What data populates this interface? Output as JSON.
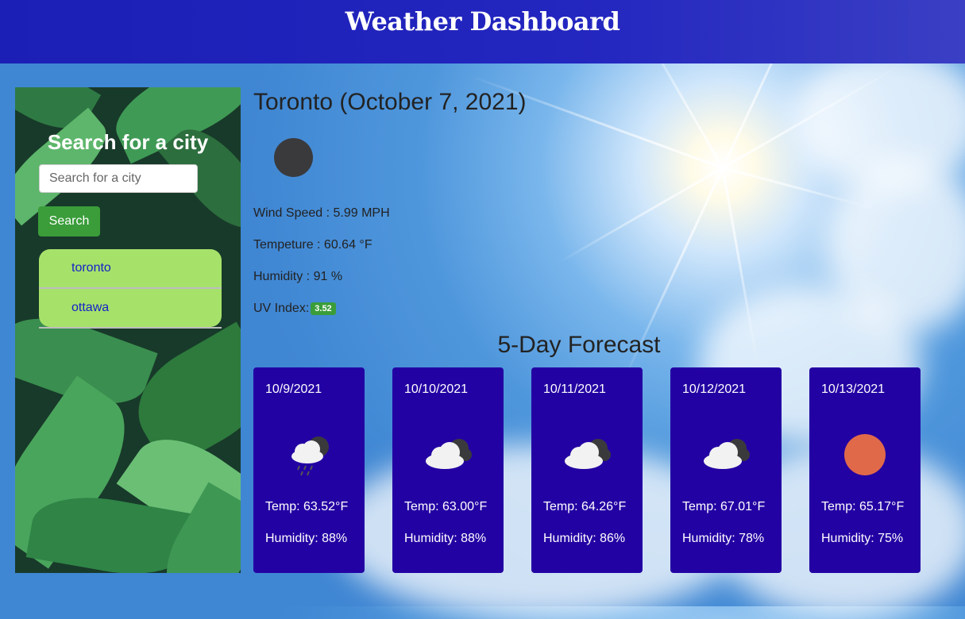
{
  "header": {
    "title": "Weather Dashboard"
  },
  "sidebar": {
    "title": "Search for a city",
    "search_placeholder": "Search for a city",
    "search_button": "Search",
    "history": [
      "toronto",
      "ottawa"
    ]
  },
  "current": {
    "title": "Toronto (October 7, 2021)",
    "icon": "night-clear-icon",
    "wind": "Wind Speed : 5.99 MPH",
    "temp": "Tempeture : 60.64 °F",
    "humidity": "Humidity : 91 %",
    "uv_label": "UV Index:",
    "uv_value": "3.52"
  },
  "forecast": {
    "title": "5-Day Forecast",
    "days": [
      {
        "date": "10/9/2021",
        "icon": "cloud-rain-icon",
        "temp": "Temp: 63.52°F",
        "humidity": "Humidity: 88%"
      },
      {
        "date": "10/10/2021",
        "icon": "cloudy-icon",
        "temp": "Temp: 63.00°F",
        "humidity": "Humidity: 88%"
      },
      {
        "date": "10/11/2021",
        "icon": "cloudy-icon",
        "temp": "Temp: 64.26°F",
        "humidity": "Humidity: 86%"
      },
      {
        "date": "10/12/2021",
        "icon": "cloudy-icon",
        "temp": "Temp: 67.01°F",
        "humidity": "Humidity: 78%"
      },
      {
        "date": "10/13/2021",
        "icon": "sun-icon",
        "temp": "Temp: 65.17°F",
        "humidity": "Humidity: 75%"
      }
    ]
  },
  "colors": {
    "header": "#1b1fb5",
    "card": "#2302a3",
    "search_button": "#3a9d3a",
    "history_bg": "#a6e26a",
    "history_link": "#1520c8",
    "uv_badge": "#3a9d3a",
    "sun": "#e0694a"
  }
}
